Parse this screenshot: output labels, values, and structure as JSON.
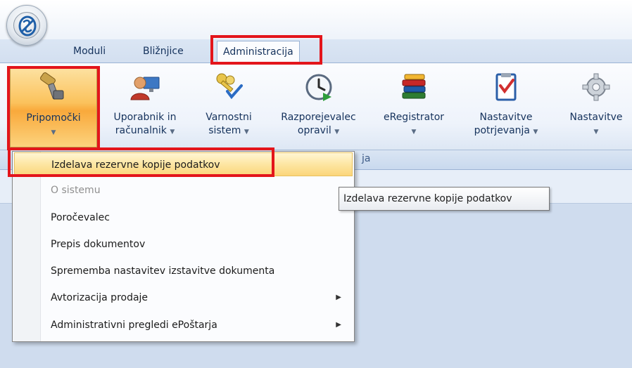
{
  "menu_tabs": [
    "Moduli",
    "Bližnjice",
    "Administracija"
  ],
  "ribbon": {
    "buttons": [
      {
        "line1": "Pripomočki",
        "line2": "",
        "icon": "wrench-tools-icon"
      },
      {
        "line1": "Uporabnik in",
        "line2": "računalnik",
        "icon": "user-computer-icon"
      },
      {
        "line1": "Varnostni",
        "line2": "sistem",
        "icon": "keys-checkmark-icon"
      },
      {
        "line1": "Razporejevalec",
        "line2": "opravil",
        "icon": "clock-play-icon"
      },
      {
        "line1": "eRegistrator",
        "line2": "",
        "icon": "books-stack-icon"
      },
      {
        "line1": "Nastavitve",
        "line2": "potrjevanja",
        "icon": "checklist-icon"
      },
      {
        "line1": "Nastavitve",
        "line2": "",
        "icon": "gear-icon"
      }
    ],
    "group_label_fragment": "ja"
  },
  "dropdown": {
    "items": [
      {
        "label": "Izdelava rezervne kopije podatkov",
        "state": "highlighted"
      },
      {
        "label": "O sistemu",
        "state": "disabled"
      },
      {
        "label": "Poročevalec",
        "state": "normal"
      },
      {
        "label": "Prepis dokumentov",
        "state": "normal"
      },
      {
        "label": "Sprememba nastavitev izstavitve dokumenta",
        "state": "normal"
      },
      {
        "label": "Avtorizacija prodaje",
        "state": "submenu"
      },
      {
        "label": "Administrativni pregledi ePoštarja",
        "state": "submenu"
      }
    ]
  },
  "tooltip": "Izdelava rezervne kopije podatkov",
  "colors": {
    "highlight_box": "#e3151b",
    "ribbon_text": "#15325c",
    "pressed_button": "#f9a93b",
    "workspace": "#cfdcee"
  }
}
